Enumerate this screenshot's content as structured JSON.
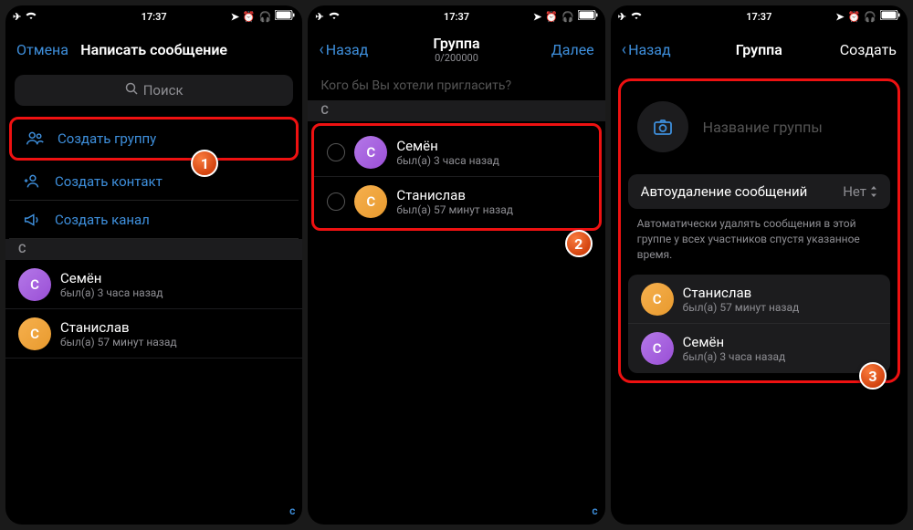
{
  "status": {
    "time": "17:37"
  },
  "screen1": {
    "cancel": "Отмена",
    "title": "Написать сообщение",
    "search_placeholder": "Поиск",
    "actions": {
      "group": "Создать группу",
      "contact": "Создать контакт",
      "channel": "Создать канал"
    },
    "section": "С",
    "contacts": [
      {
        "initial": "С",
        "name": "Семён",
        "status": "был(а) 3 часа назад",
        "avatar": "purple"
      },
      {
        "initial": "С",
        "name": "Станислав",
        "status": "был(а) 57 минут назад",
        "avatar": "orange"
      }
    ],
    "index": "с",
    "badge": "1"
  },
  "screen2": {
    "back": "Назад",
    "title": "Группа",
    "subtitle": "0/200000",
    "next": "Далее",
    "invite_placeholder": "Кого бы Вы хотели пригласить?",
    "section": "С",
    "contacts": [
      {
        "initial": "С",
        "name": "Семён",
        "status": "был(а) 3 часа назад",
        "avatar": "purple"
      },
      {
        "initial": "С",
        "name": "Станислав",
        "status": "был(а) 57 минут назад",
        "avatar": "orange"
      }
    ],
    "index": "с",
    "badge": "2"
  },
  "screen3": {
    "back": "Назад",
    "title": "Группа",
    "create": "Создать",
    "name_placeholder": "Название группы",
    "autodelete_label": "Автоудаление сообщений",
    "autodelete_value": "Нет",
    "autodelete_hint": "Автоматически удалять сообщения в этой группе у всех участников спустя указанное время.",
    "members": [
      {
        "initial": "С",
        "name": "Станислав",
        "status": "был(а) 57 минут назад",
        "avatar": "orange"
      },
      {
        "initial": "С",
        "name": "Семён",
        "status": "был(а) 3 часа назад",
        "avatar": "purple"
      }
    ],
    "badge": "3"
  }
}
